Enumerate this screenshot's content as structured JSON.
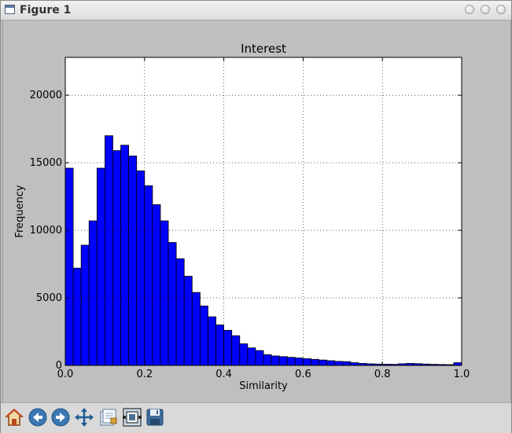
{
  "window": {
    "title": "Figure 1",
    "icon": "window-icon",
    "controls": [
      "minimize-icon",
      "maximize-icon",
      "close-icon"
    ]
  },
  "toolbar": {
    "items": [
      {
        "name": "home-button",
        "icon": "home-icon"
      },
      {
        "name": "back-button",
        "icon": "arrow-left-icon"
      },
      {
        "name": "forward-button",
        "icon": "arrow-right-icon"
      },
      {
        "name": "pan-button",
        "icon": "move-icon"
      },
      {
        "name": "subplots-button",
        "icon": "configure-subplots-icon"
      },
      {
        "name": "edit-button",
        "icon": "edit-axes-icon"
      },
      {
        "name": "save-button",
        "icon": "save-icon"
      }
    ]
  },
  "chart_data": {
    "type": "bar",
    "title": "Interest",
    "xlabel": "Similarity",
    "ylabel": "Frequency",
    "xlim": [
      0.0,
      1.0
    ],
    "ylim": [
      0,
      22800
    ],
    "bin_width": 0.02,
    "bin_starts": [
      0.0,
      0.02,
      0.04,
      0.06,
      0.08,
      0.1,
      0.12,
      0.14,
      0.16,
      0.18,
      0.2,
      0.22,
      0.24,
      0.26,
      0.28,
      0.3,
      0.32,
      0.34,
      0.36,
      0.38,
      0.4,
      0.42,
      0.44,
      0.46,
      0.48,
      0.5,
      0.52,
      0.54,
      0.56,
      0.58,
      0.6,
      0.62,
      0.64,
      0.66,
      0.68,
      0.7,
      0.72,
      0.74,
      0.76,
      0.78,
      0.8,
      0.82,
      0.84,
      0.86,
      0.88,
      0.9,
      0.92,
      0.94,
      0.96,
      0.98
    ],
    "values": [
      14600,
      7200,
      8900,
      10700,
      14600,
      17000,
      15900,
      16300,
      15500,
      14400,
      13300,
      11900,
      10700,
      9100,
      7900,
      6600,
      5400,
      4400,
      3600,
      3000,
      2600,
      2200,
      1600,
      1300,
      1100,
      800,
      700,
      650,
      600,
      550,
      500,
      450,
      400,
      350,
      300,
      280,
      200,
      150,
      120,
      100,
      90,
      80,
      120,
      150,
      130,
      100,
      80,
      70,
      60,
      200
    ],
    "bar_color": "#0000ff",
    "x_ticks": [
      "0.0",
      "0.2",
      "0.4",
      "0.6",
      "0.8",
      "1.0"
    ],
    "x_tick_values": [
      0.0,
      0.2,
      0.4,
      0.6,
      0.8,
      1.0
    ],
    "y_ticks": [
      "0",
      "5000",
      "10000",
      "15000",
      "20000"
    ],
    "y_tick_values": [
      0,
      5000,
      10000,
      15000,
      20000
    ],
    "grid": true,
    "grid_style": "dotted",
    "legend": "none"
  }
}
